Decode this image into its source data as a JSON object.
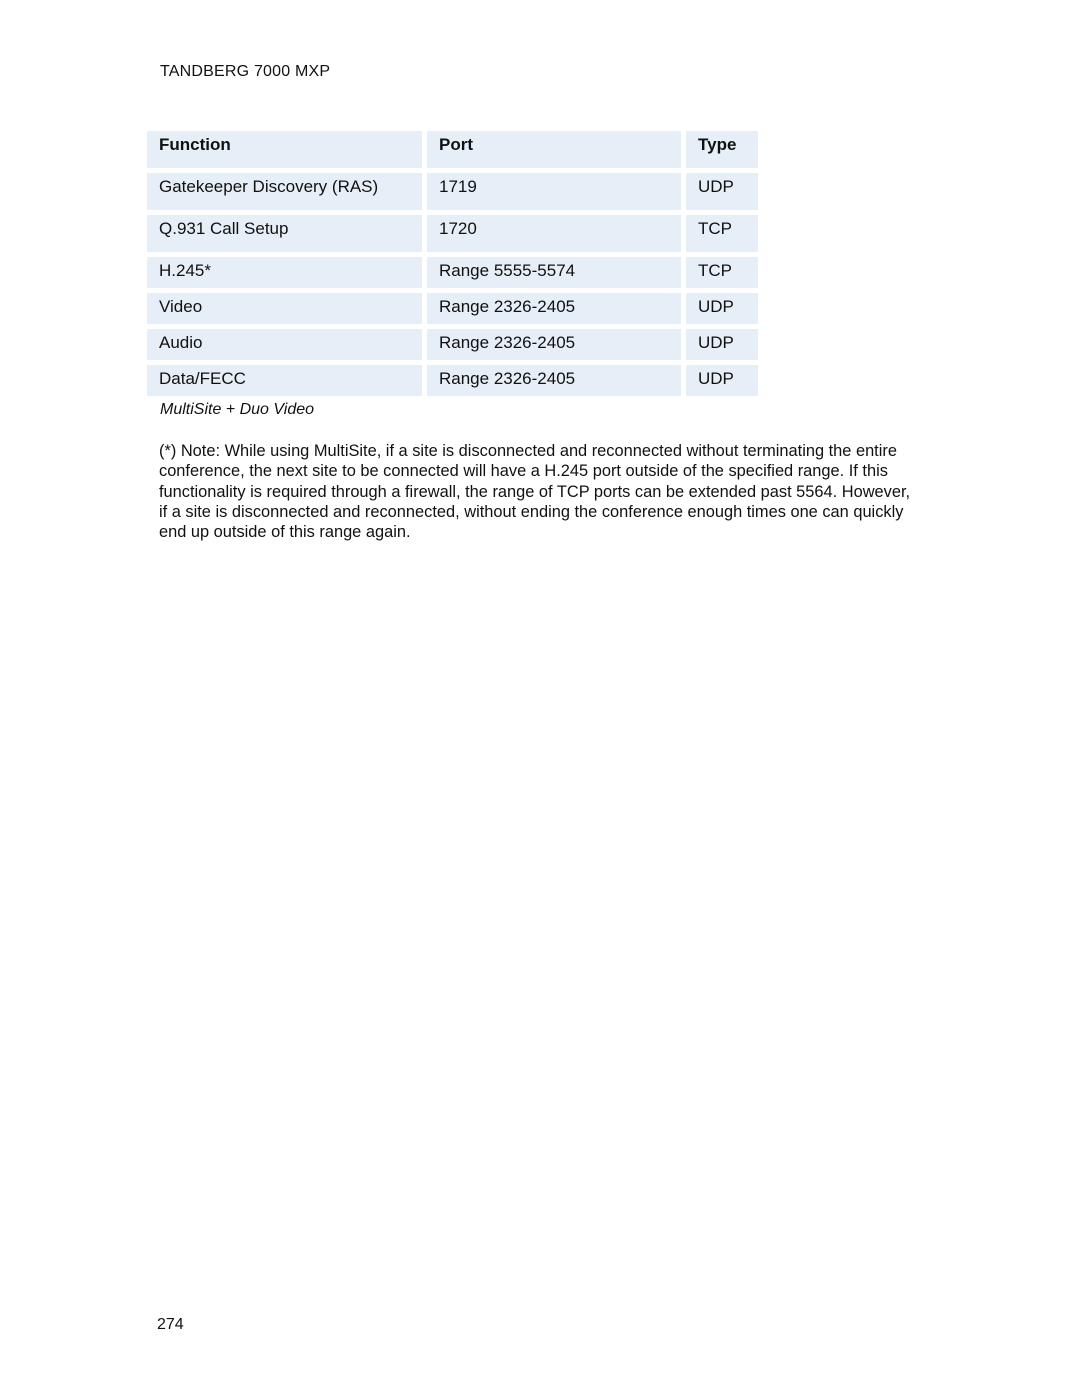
{
  "header": {
    "title": "TANDBERG 7000 MXP"
  },
  "table": {
    "columns": [
      "Function",
      "Port",
      "Type"
    ],
    "rows": [
      [
        "Gatekeeper Discovery (RAS)",
        "1719",
        "UDP"
      ],
      [
        "Q.931 Call Setup",
        "1720",
        "TCP"
      ],
      [
        "H.245*",
        "Range 5555-5574",
        "TCP"
      ],
      [
        "Video",
        "Range 2326-2405",
        "UDP"
      ],
      [
        "Audio",
        "Range 2326-2405",
        "UDP"
      ],
      [
        "Data/FECC",
        "Range 2326-2405",
        "UDP"
      ]
    ],
    "caption": "MultiSite + Duo Video"
  },
  "note": "(*) Note: While using MultiSite, if a site is disconnected and reconnected without terminating the entire conference, the next site to be connected will have a H.245 port outside of the specified range. If this functionality is required through a firewall, the range of TCP ports can be extended past 5564. However, if a site is disconnected and reconnected, without ending the conference enough times one can quickly end up outside of this range again.",
  "footer": {
    "page_number": "274"
  }
}
